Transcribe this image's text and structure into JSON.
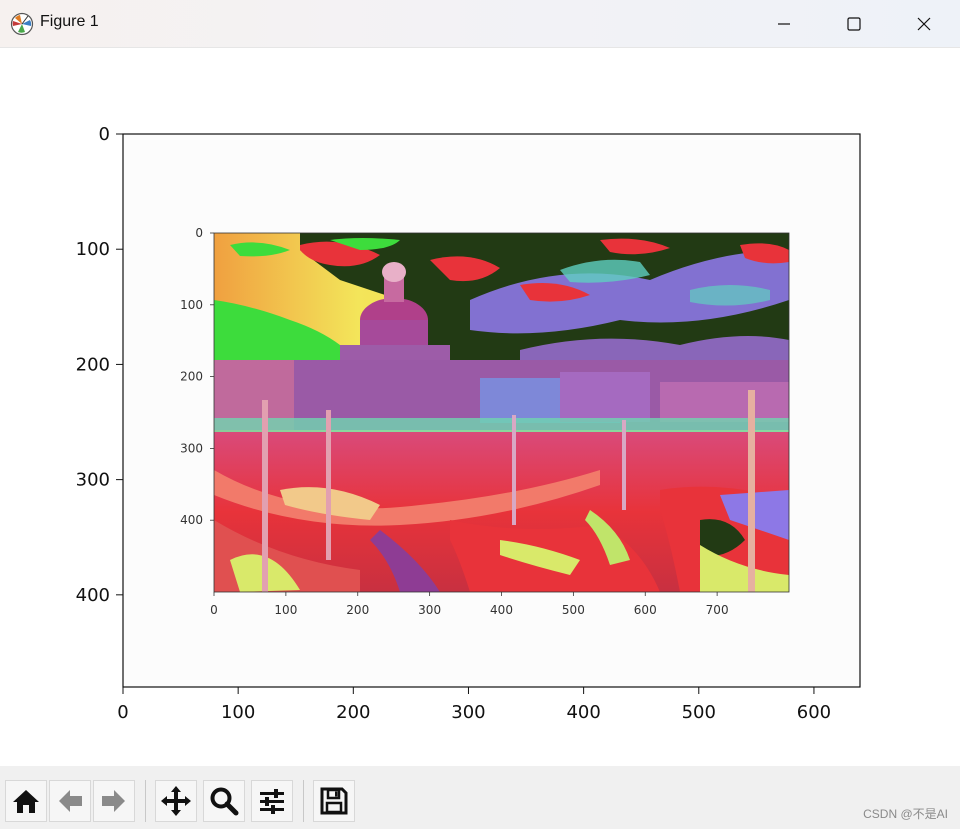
{
  "window": {
    "title": "Figure 1",
    "controls": [
      "minimize-icon",
      "maximize-icon",
      "close-icon"
    ]
  },
  "outer_axes": {
    "x_ticks": [
      "0",
      "100",
      "200",
      "300",
      "400",
      "500",
      "600"
    ],
    "y_ticks": [
      "0",
      "100",
      "200",
      "300",
      "400"
    ]
  },
  "inner_image": {
    "x_ticks": [
      "0",
      "100",
      "200",
      "300",
      "400",
      "500",
      "600",
      "700"
    ],
    "y_ticks": [
      "0",
      "100",
      "200",
      "300",
      "400"
    ]
  },
  "toolbar": {
    "buttons": [
      {
        "name": "home-button",
        "icon": "home-icon"
      },
      {
        "name": "back-button",
        "icon": "arrow-left-icon"
      },
      {
        "name": "forward-button",
        "icon": "arrow-right-icon"
      },
      {
        "name": "pan-button",
        "icon": "move-icon"
      },
      {
        "name": "zoom-button",
        "icon": "magnifier-icon"
      },
      {
        "name": "configure-subplots-button",
        "icon": "sliders-icon"
      },
      {
        "name": "save-button",
        "icon": "floppy-disk-icon"
      }
    ]
  },
  "watermark": "CSDN @不是AI",
  "colors": {
    "red": "#e8333a",
    "green": "#3ddc3c",
    "yellow": "#f3e55a",
    "purple": "#8e3c94",
    "violet": "#8d78e6",
    "dark": "#223a14"
  }
}
